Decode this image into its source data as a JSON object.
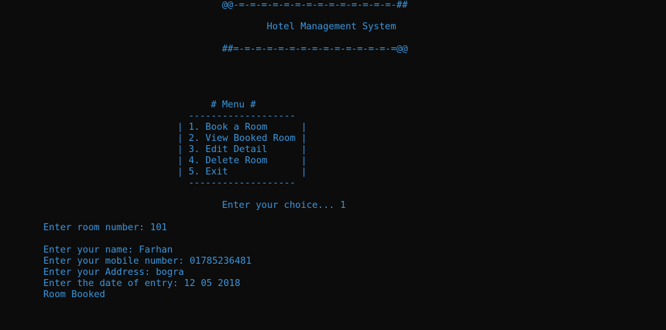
{
  "colors": {
    "background": "#0c0c0c",
    "foreground": "#3a96dd"
  },
  "banner": {
    "top_border": "@@-=-=-=-=-=-=-=-=-=-=-=-=-=-=-##",
    "title": "Hotel Management System",
    "bottom_border": "##=-=-=-=-=-=-=-=-=-=-=-=-=-=-=@@"
  },
  "menu": {
    "heading": "# Menu #",
    "top_rule": "-------------------",
    "items": [
      "| 1. Book a Room      |",
      "| 2. View Booked Room |",
      "| 3. Edit Detail      |",
      "| 4. Delete Room      |",
      "| 5. Exit             |"
    ],
    "bottom_rule": "-------------------"
  },
  "choice_prompt": "Enter your choice... 1",
  "room_number_prompt": "Enter room number: 101",
  "name_prompt": "Enter your name: Farhan",
  "mobile_prompt": "Enter your mobile number: 01785236481",
  "address_prompt": "Enter your Address: bogra",
  "date_prompt": "Enter the date of entry: 12 05 2018",
  "result_message": "Room Booked"
}
